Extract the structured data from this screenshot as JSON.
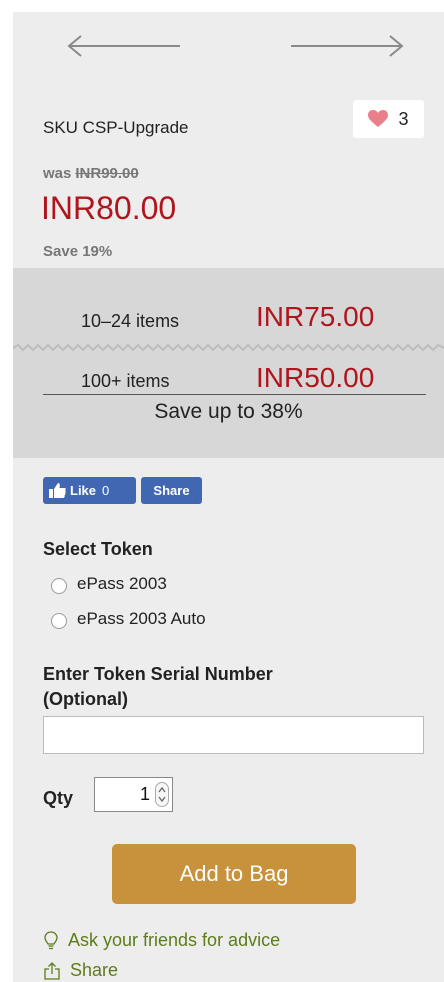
{
  "nav": {
    "prev_icon": "arrow-left-icon",
    "next_icon": "arrow-right-icon"
  },
  "product": {
    "sku": "SKU CSP-Upgrade",
    "wishlist_count": "3",
    "was_prefix": "was",
    "was_price": "INR99.00",
    "price": "INR80.00",
    "save_text": "Save 19%"
  },
  "tiers": {
    "items": [
      {
        "label": "10–24 items",
        "price": "INR75.00"
      },
      {
        "label": "100+ items",
        "price": "INR50.00"
      }
    ],
    "save_up_to": "Save up to 38%"
  },
  "social": {
    "like_label": "Like",
    "like_count": "0",
    "share_label": "Share"
  },
  "token": {
    "title": "Select Token",
    "options": [
      "ePass 2003",
      "ePass 2003 Auto"
    ]
  },
  "serial": {
    "title_line1": "Enter Token Serial Number",
    "title_line2": "(Optional)",
    "value": ""
  },
  "qty": {
    "label": "Qty",
    "value": "1"
  },
  "add_to_bag": "Add to Bag",
  "links": {
    "ask_friends": "Ask your friends for advice",
    "share": "Share"
  },
  "colors": {
    "price_red": "#b0141c",
    "button_gold": "#c8913b",
    "link_green": "#5d7c1a",
    "facebook_blue": "#4267b2",
    "heart_pink": "#e8808c"
  }
}
